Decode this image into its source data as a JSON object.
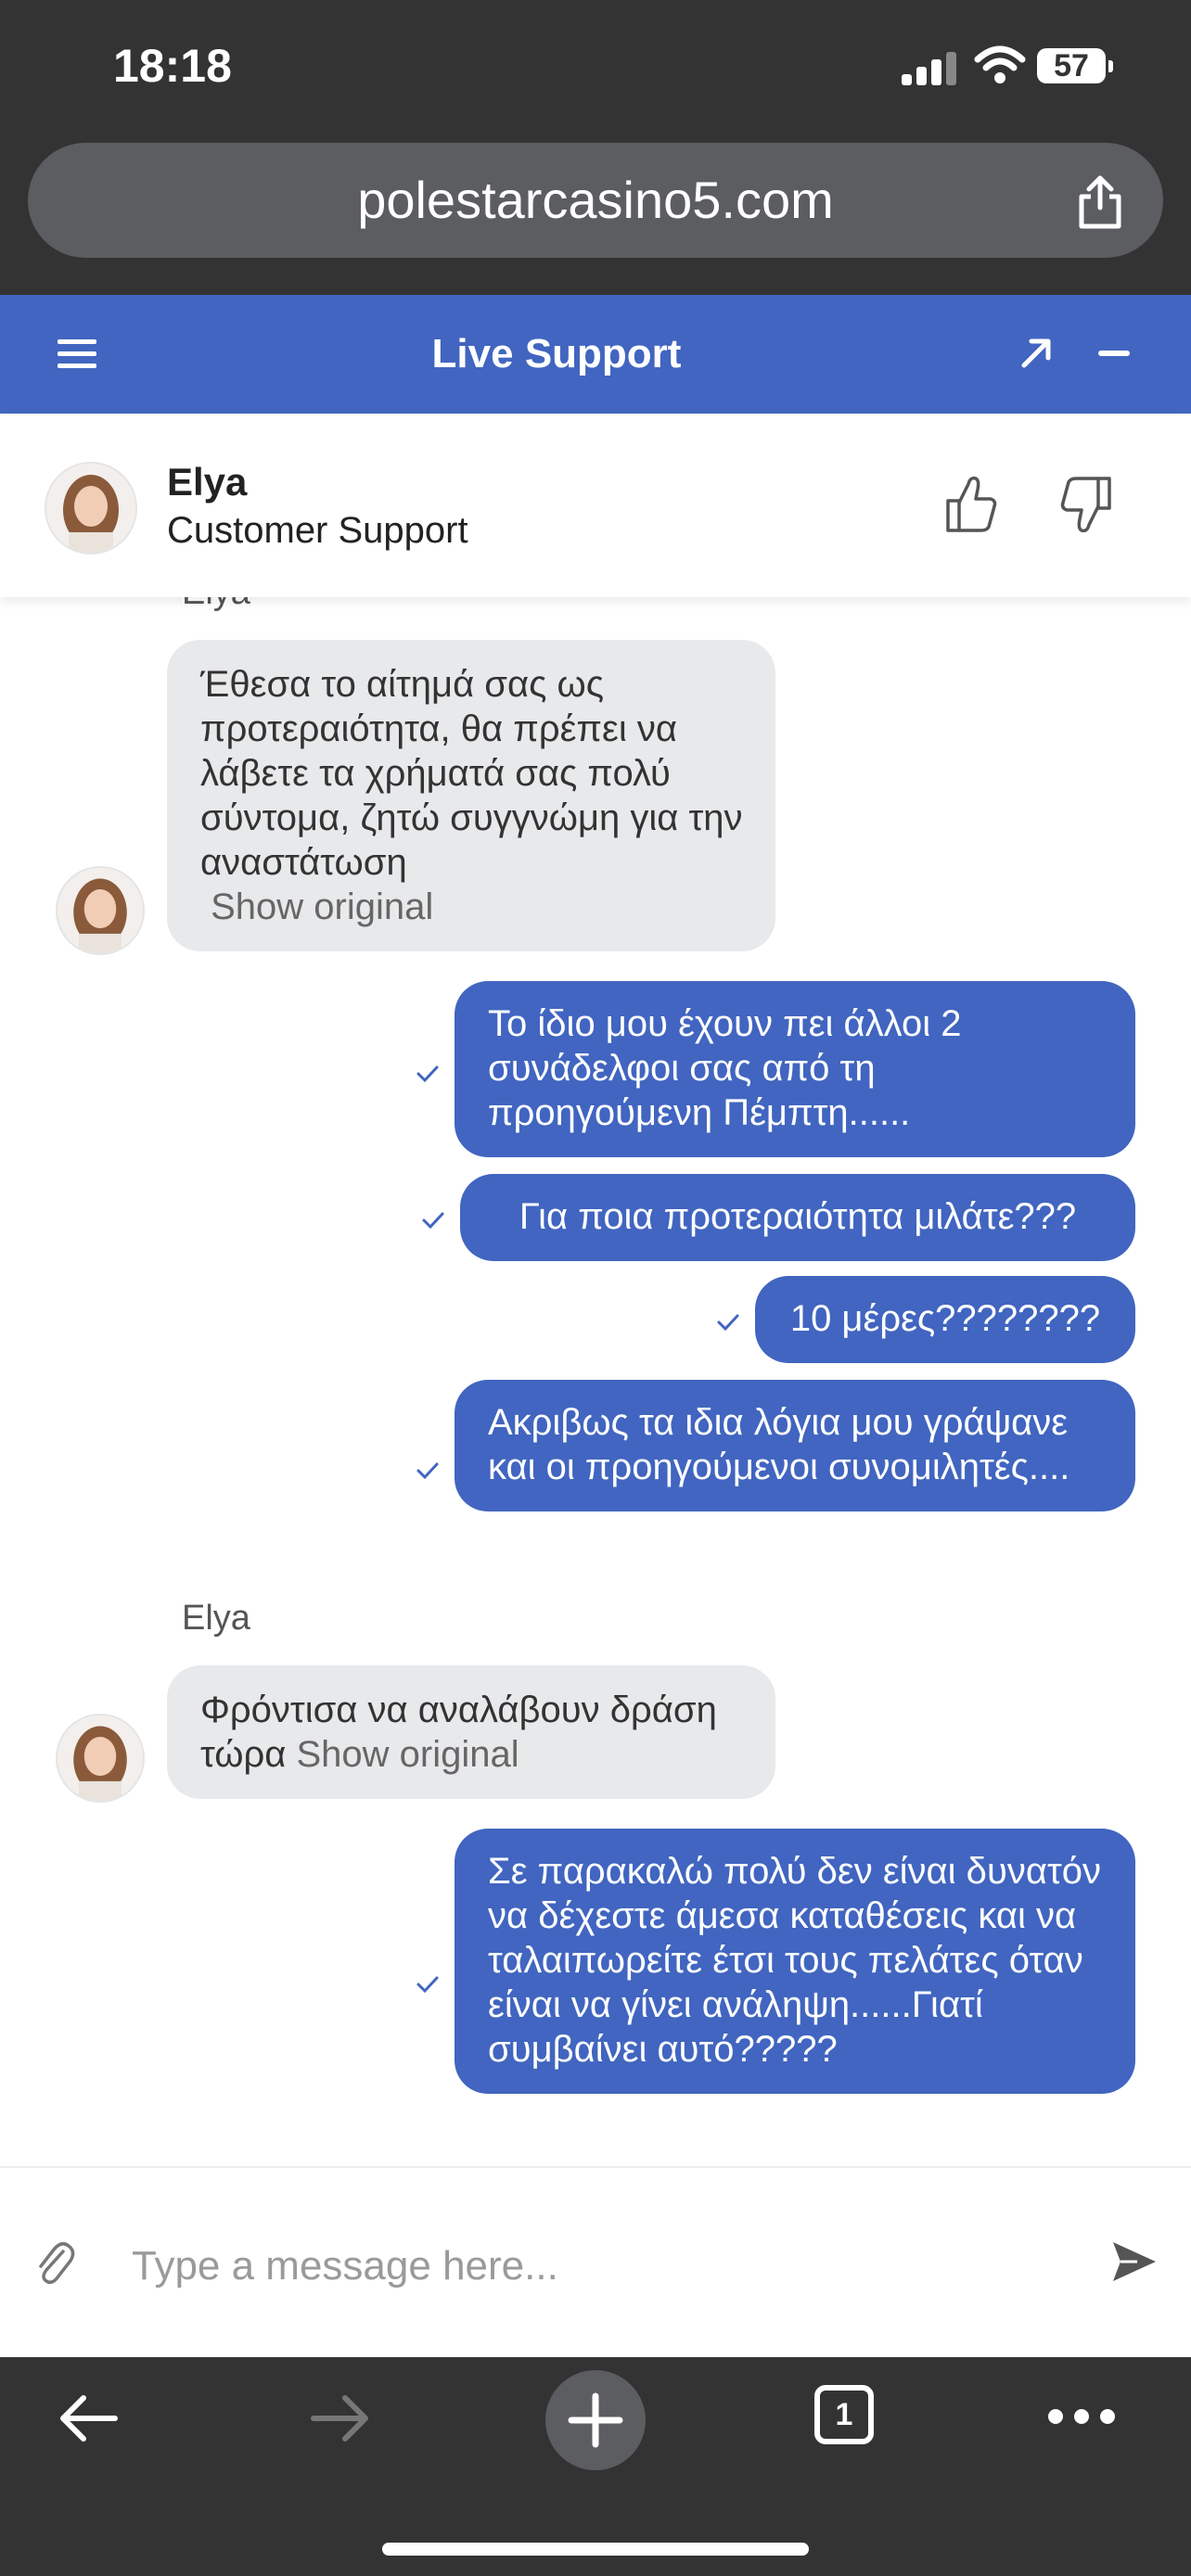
{
  "status_bar": {
    "time": "18:18",
    "battery": "57"
  },
  "browser": {
    "url": "polestarcasino5.com",
    "tab_count": "1"
  },
  "support_header": {
    "title": "Live Support"
  },
  "agent": {
    "name": "Elya",
    "role": "Customer Support"
  },
  "messages": [
    {
      "from": "agent",
      "sender": "Elya",
      "text": "Έθεσα το αίτημά σας ως προτεραιότητα, θα πρέπει να λάβετε τα χρήματά σας πολύ σύντομα, ζητώ συγγνώμη για την αναστάτωση",
      "show_original": "Show original"
    },
    {
      "from": "user",
      "text": "Το ίδιο μου έχουν πει άλλοι 2 συνάδελφοι σας από τη προηγούμενη Πέμπτη......"
    },
    {
      "from": "user",
      "text": "Για ποια προτεραιότητα μιλάτε???"
    },
    {
      "from": "user",
      "text": "10 μέρες????????"
    },
    {
      "from": "user",
      "text": "Ακριβως τα ιδια λόγια μου γράψανε και οι προηγούμενοι συνομιλητές...."
    },
    {
      "from": "agent",
      "sender": "Elya",
      "text": "Φρόντισα να αναλάβουν δράση τώρα",
      "show_original": "Show original"
    },
    {
      "from": "user",
      "text": "Σε παρακαλώ πολύ δεν είναι δυνατόν να δέχεστε άμεσα καταθέσεις και να ταλαιπωρείτε έτσι τους πελάτες όταν είναι να γίνει ανάληψη......Γιατί συμβαίνει αυτό?????"
    }
  ],
  "composer": {
    "placeholder": "Type a message here..."
  },
  "colors": {
    "accent": "#4165c0",
    "agent_bubble": "#e8e9eb",
    "chrome": "#333333"
  }
}
